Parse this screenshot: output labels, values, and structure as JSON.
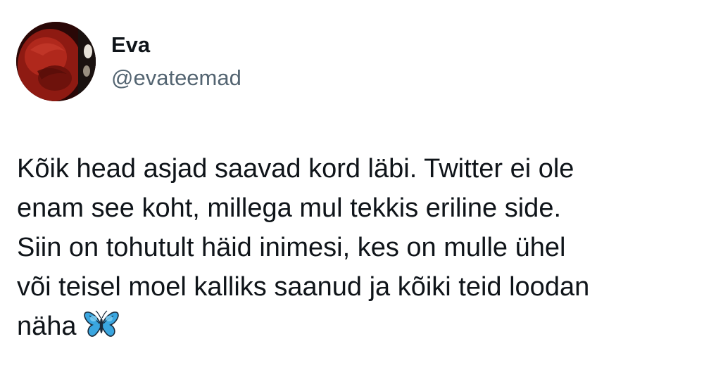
{
  "author": {
    "display_name": "Eva",
    "handle": "@evateemad",
    "avatar_icon": "profile-photo"
  },
  "tweet": {
    "lines": [
      "Kõik head asjad saavad kord läbi. Twitter ei ole",
      "enam see koht, millega mul tekkis eriline side.",
      "Siin on tohutult häid inimesi, kes on mulle ühel",
      "või teisel moel kalliks saanud ja kõiki teid loodan",
      "näha"
    ],
    "emoji": "butterfly-icon"
  },
  "colors": {
    "text_primary": "#0f1419",
    "text_secondary": "#536471",
    "background": "#ffffff",
    "butterfly": "#3aa6e0"
  }
}
